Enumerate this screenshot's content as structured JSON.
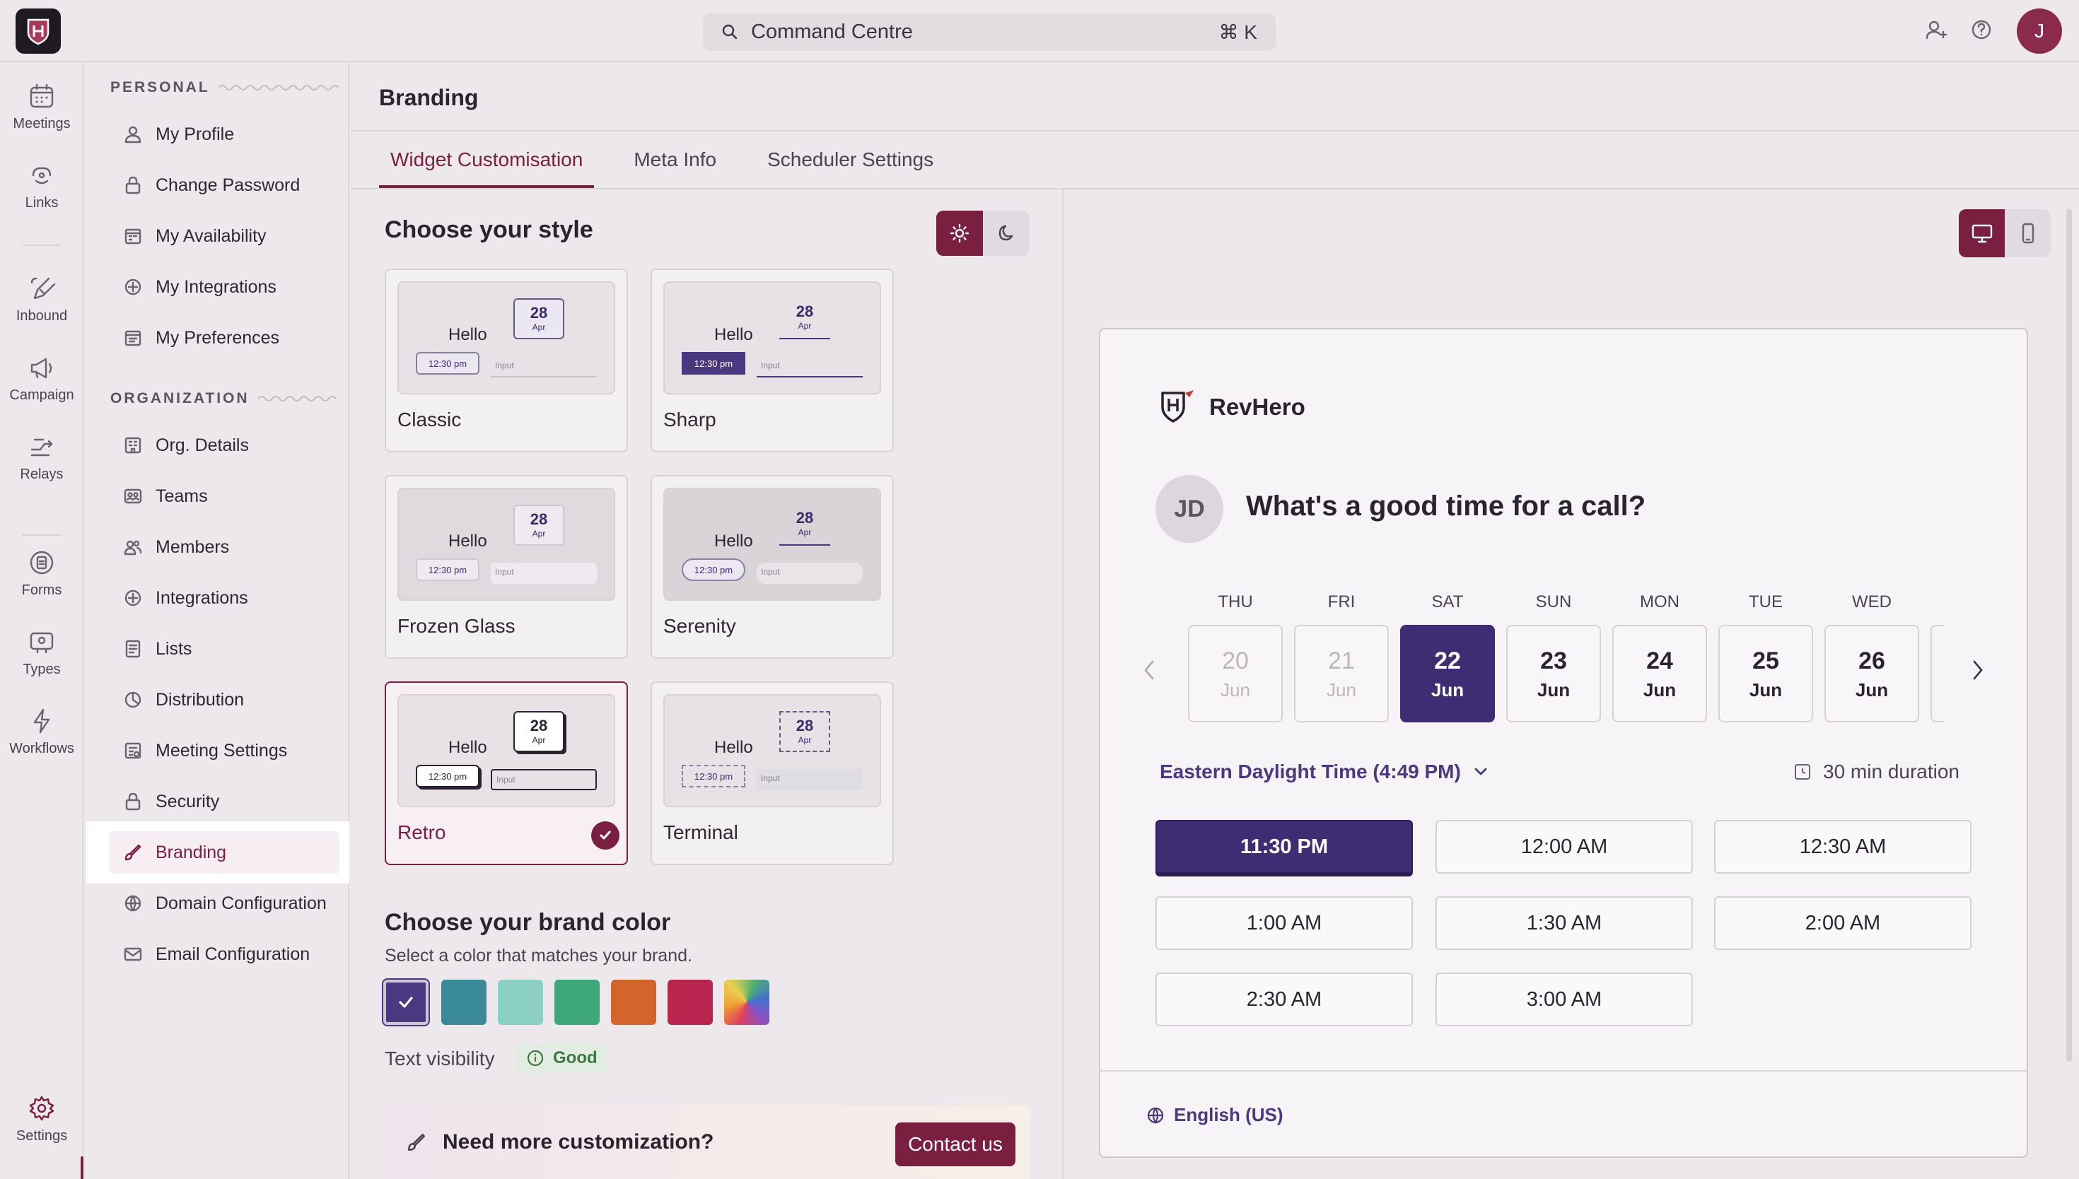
{
  "topbar": {
    "search_label": "Command Centre",
    "shortcut": "⌘ K",
    "avatar_initial": "J",
    "icons": [
      "add-user-icon",
      "help-icon"
    ]
  },
  "rail": {
    "items": [
      {
        "label": "Meetings",
        "icon": "calendar-icon"
      },
      {
        "label": "Links",
        "icon": "link-icon"
      },
      {
        "label": "Inbound",
        "icon": "inbound-icon"
      },
      {
        "label": "Campaign",
        "icon": "megaphone-icon"
      },
      {
        "label": "Relays",
        "icon": "relay-icon"
      },
      {
        "label": "Forms",
        "icon": "form-icon"
      },
      {
        "label": "Types",
        "icon": "types-icon"
      },
      {
        "label": "Workflows",
        "icon": "bolt-icon"
      },
      {
        "label": "Settings",
        "icon": "gear-icon"
      }
    ],
    "active": "Settings"
  },
  "sidebar": {
    "personal_heading": "PERSONAL",
    "personal": [
      "My Profile",
      "Change Password",
      "My Availability",
      "My Integrations",
      "My Preferences"
    ],
    "org_heading": "ORGANIZATION",
    "org": [
      "Org. Details",
      "Teams",
      "Members",
      "Integrations",
      "Lists",
      "Distribution",
      "Meeting Settings",
      "Security",
      "Branding",
      "Domain Configuration",
      "Email Configuration"
    ],
    "active": "Branding"
  },
  "main": {
    "title": "Branding",
    "tabs": [
      "Widget Customisation",
      "Meta Info",
      "Scheduler Settings"
    ],
    "active_tab": "Widget Customisation"
  },
  "style_section": {
    "heading": "Choose your style",
    "theme": "light",
    "preview": {
      "hello": "Hello",
      "date_num": "28",
      "date_month": "Apr",
      "time": "12:30 pm",
      "input": "Input"
    },
    "styles": [
      "Classic",
      "Sharp",
      "Frozen Glass",
      "Serenity",
      "Retro",
      "Terminal"
    ],
    "selected": "Retro"
  },
  "brand_color": {
    "heading": "Choose your brand color",
    "subtitle": "Select a color that matches your brand.",
    "swatches": [
      "#4a3880",
      "#3a8a9a",
      "#8cd0c4",
      "#3fa87a",
      "#d4652a",
      "#b8264f",
      "rainbow"
    ],
    "selected": "#4a3880",
    "visibility_label": "Text visibility",
    "visibility_value": "Good"
  },
  "promo": {
    "text": "Need more customization?",
    "button": "Contact us"
  },
  "preview_panel": {
    "device": "desktop",
    "brand_name": "RevHero",
    "initials": "JD",
    "question": "What's a good time for a call?",
    "days": [
      {
        "dow": "THU",
        "num": "20",
        "mon": "Jun",
        "state": "disabled"
      },
      {
        "dow": "FRI",
        "num": "21",
        "mon": "Jun",
        "state": "disabled"
      },
      {
        "dow": "SAT",
        "num": "22",
        "mon": "Jun",
        "state": "selected"
      },
      {
        "dow": "SUN",
        "num": "23",
        "mon": "Jun",
        "state": "normal"
      },
      {
        "dow": "MON",
        "num": "24",
        "mon": "Jun",
        "state": "normal"
      },
      {
        "dow": "TUE",
        "num": "25",
        "mon": "Jun",
        "state": "normal"
      },
      {
        "dow": "WED",
        "num": "26",
        "mon": "Jun",
        "state": "normal"
      }
    ],
    "timezone": "Eastern Daylight Time (4:49 PM)",
    "duration": "30 min duration",
    "slots": [
      "11:30 PM",
      "12:00 AM",
      "12:30 AM",
      "1:00 AM",
      "1:30 AM",
      "2:00 AM",
      "2:30 AM",
      "3:00 AM"
    ],
    "selected_slot": "11:30 PM",
    "language": "English (US)"
  }
}
